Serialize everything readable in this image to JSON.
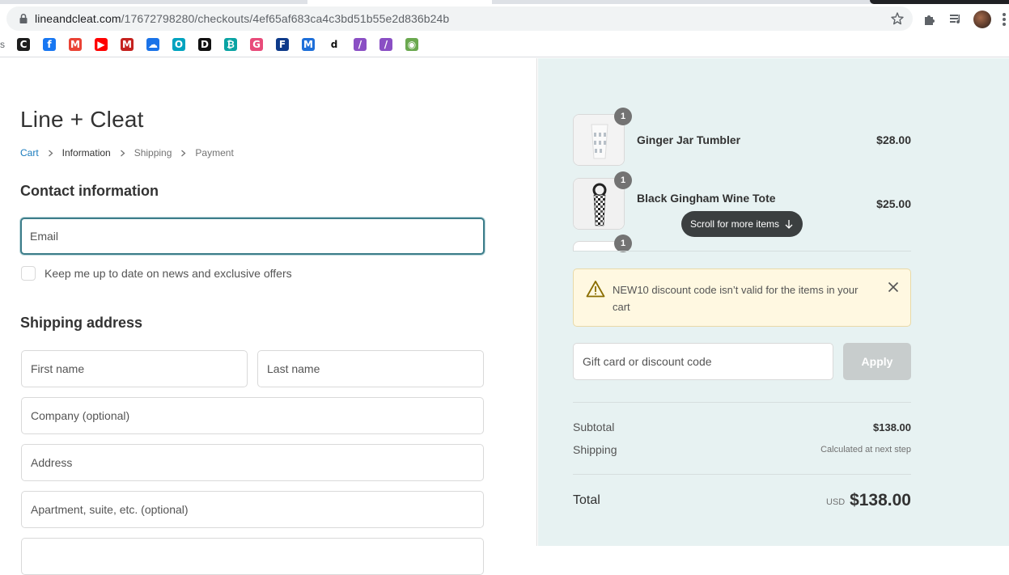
{
  "browser": {
    "url_host": "lineandcleat.com",
    "url_path": "/17672798280/checkouts/4ef65af683ca4c3bd51b55e2d836b24b",
    "bookmarks": [
      {
        "icon": "c-logo-icon",
        "letter": "C",
        "color": "#1d1d1d"
      },
      {
        "icon": "facebook-icon",
        "letter": "f",
        "color": "#1877f2"
      },
      {
        "icon": "gmail-icon",
        "letter": "M",
        "color": "#ea4335"
      },
      {
        "icon": "youtube-icon",
        "letter": "▶",
        "color": "#ff0000"
      },
      {
        "icon": "gmail-icon",
        "letter": "M",
        "color": "#c5221f"
      },
      {
        "icon": "cloud-icon",
        "letter": "☁",
        "color": "#1a73e8"
      },
      {
        "icon": "square-o-icon",
        "letter": "O",
        "color": "#00a3bf"
      },
      {
        "icon": "d-logo-icon",
        "letter": "D",
        "color": "#111111"
      },
      {
        "icon": "coin-icon",
        "letter": "₿",
        "color": "#0aa3a3"
      },
      {
        "icon": "app-icon",
        "letter": "G",
        "color": "#e84b7a"
      },
      {
        "icon": "f-logo-icon",
        "letter": "F",
        "color": "#0e3a8a"
      },
      {
        "icon": "m-logo-icon",
        "letter": "M",
        "color": "#1e6fd9"
      },
      {
        "icon": "d-small-icon",
        "letter": "d",
        "color": "#ffffff"
      },
      {
        "icon": "feather-icon",
        "letter": "/",
        "color": "#8a4fc4"
      },
      {
        "icon": "feather-icon",
        "letter": "/",
        "color": "#8a4fc4"
      },
      {
        "icon": "globe-icon",
        "letter": "◉",
        "color": "#6aa84f"
      }
    ]
  },
  "store": {
    "title": "Line + Cleat"
  },
  "breadcrumb": {
    "cart": "Cart",
    "information": "Information",
    "shipping": "Shipping",
    "payment": "Payment"
  },
  "contact": {
    "heading": "Contact information",
    "email_placeholder": "Email",
    "newsletter_label": "Keep me up to date on news and exclusive offers"
  },
  "shipping": {
    "heading": "Shipping address",
    "first_name": "First name",
    "last_name": "Last name",
    "company": "Company (optional)",
    "address": "Address",
    "apartment": "Apartment, suite, etc. (optional)"
  },
  "cart": {
    "items": [
      {
        "name": "Ginger Jar Tumbler",
        "price": "$28.00",
        "qty": "1"
      },
      {
        "name": "Black Gingham Wine Tote",
        "price": "$25.00",
        "qty": "1"
      },
      {
        "name": "",
        "price": "",
        "qty": "1"
      }
    ],
    "scroll_hint": "Scroll for more items"
  },
  "alert": {
    "text": "NEW10 discount code isn’t valid for the items in your cart"
  },
  "discount": {
    "placeholder": "Gift card or discount code",
    "apply_label": "Apply"
  },
  "summary": {
    "subtotal_label": "Subtotal",
    "subtotal_value": "$138.00",
    "shipping_label": "Shipping",
    "shipping_value": "Calculated at next step",
    "total_label": "Total",
    "currency": "USD",
    "total_value": "$138.00"
  },
  "colors": {
    "accent": "#197bbd",
    "focus": "#3d7d8a",
    "sidebar_bg": "#e7f2f2",
    "alert_bg": "#fff8e1"
  }
}
